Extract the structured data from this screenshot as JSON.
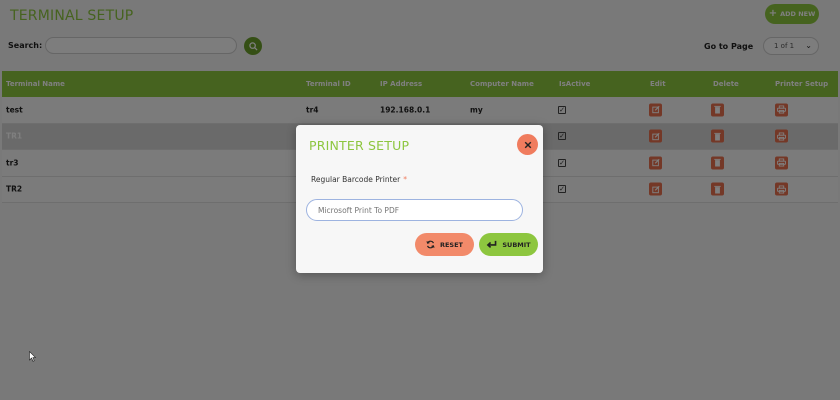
{
  "header": {
    "title": "TERMINAL SETUP",
    "add_new_label": "ADD NEW"
  },
  "toolbar": {
    "search_label": "Search:",
    "search_value": "",
    "go_to_page_label": "Go to Page",
    "page_select_value": "1 of 1"
  },
  "table": {
    "columns": [
      "Terminal Name",
      "Terminal ID",
      "IP Address",
      "Computer Name",
      "IsActive",
      "Edit",
      "Delete",
      "Printer Setup"
    ],
    "rows": [
      {
        "name": "test",
        "id": "tr4",
        "ip": "192.168.0.1",
        "computer": "my",
        "active": true
      },
      {
        "name": "TR1",
        "id": "",
        "ip": "",
        "computer": "",
        "active": true
      },
      {
        "name": "tr3",
        "id": "",
        "ip": "",
        "computer": "",
        "active": true
      },
      {
        "name": "TR2",
        "id": "",
        "ip": "",
        "computer": "",
        "active": true
      }
    ]
  },
  "modal": {
    "title": "PRINTER SETUP",
    "field_label": "Regular Barcode Printer",
    "required_mark": "*",
    "field_value": "",
    "field_placeholder": "Microsoft Print To PDF",
    "reset_label": "RESET",
    "submit_label": "SUBMIT"
  },
  "colors": {
    "accent_green": "#8dc63f",
    "action_orange": "#e8704e",
    "close_orange": "#f07c5e"
  }
}
